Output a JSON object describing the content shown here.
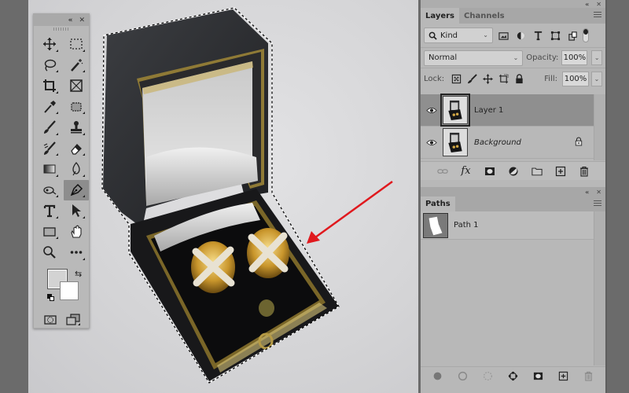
{
  "toolbox": {
    "collapse_icon": "double-chevron-left",
    "close_icon": "close",
    "tools": [
      {
        "name": "move-tool",
        "icon": "move-icon"
      },
      {
        "name": "rectangular-marquee-tool",
        "icon": "marquee-icon"
      },
      {
        "name": "lasso-tool",
        "icon": "lasso-icon"
      },
      {
        "name": "magic-wand-tool",
        "icon": "magic-wand-icon"
      },
      {
        "name": "crop-tool",
        "icon": "crop-icon"
      },
      {
        "name": "frame-tool",
        "icon": "frame-icon"
      },
      {
        "name": "eyedropper-tool",
        "icon": "eyedropper-icon"
      },
      {
        "name": "healing-brush-tool",
        "icon": "patch-icon"
      },
      {
        "name": "brush-tool",
        "icon": "brush-icon"
      },
      {
        "name": "clone-stamp-tool",
        "icon": "stamp-icon"
      },
      {
        "name": "history-brush-tool",
        "icon": "history-brush-icon"
      },
      {
        "name": "eraser-tool",
        "icon": "eraser-icon"
      },
      {
        "name": "gradient-tool",
        "icon": "gradient-icon"
      },
      {
        "name": "blur-tool",
        "icon": "blur-icon"
      },
      {
        "name": "dodge-tool",
        "icon": "dodge-icon"
      },
      {
        "name": "pen-tool",
        "icon": "pen-icon",
        "active": true
      },
      {
        "name": "type-tool",
        "icon": "type-icon",
        "glyph": "T"
      },
      {
        "name": "path-selection-tool",
        "icon": "arrow-icon"
      },
      {
        "name": "rectangle-tool",
        "icon": "rectangle-icon"
      },
      {
        "name": "hand-tool",
        "icon": "hand-icon"
      },
      {
        "name": "zoom-tool",
        "icon": "zoom-icon"
      },
      {
        "name": "more-tools",
        "icon": "ellipsis-icon",
        "glyph": "•••"
      }
    ],
    "foreground_color": "#d3d3d3",
    "background_color": "#ffffff",
    "swap_glyph": "⇆"
  },
  "canvas": {
    "annotation": "red-arrow",
    "annotation_color": "#e0191e",
    "selection": "marching-ants"
  },
  "layers_panel": {
    "tabs": [
      {
        "label": "Layers",
        "active": true
      },
      {
        "label": "Channels",
        "active": false
      }
    ],
    "filter": {
      "label": "Kind"
    },
    "blend_mode": "Normal",
    "opacity_label": "Opacity:",
    "opacity_value": "100%",
    "lock_label": "Lock:",
    "fill_label": "Fill:",
    "fill_value": "100%",
    "layers": [
      {
        "name": "Layer 1",
        "visible": true,
        "selected": true,
        "locked": false
      },
      {
        "name": "Background",
        "visible": true,
        "selected": false,
        "locked": true
      }
    ]
  },
  "paths_panel": {
    "tabs": [
      {
        "label": "Paths",
        "active": true
      }
    ],
    "paths": [
      {
        "name": "Path 1"
      }
    ]
  }
}
